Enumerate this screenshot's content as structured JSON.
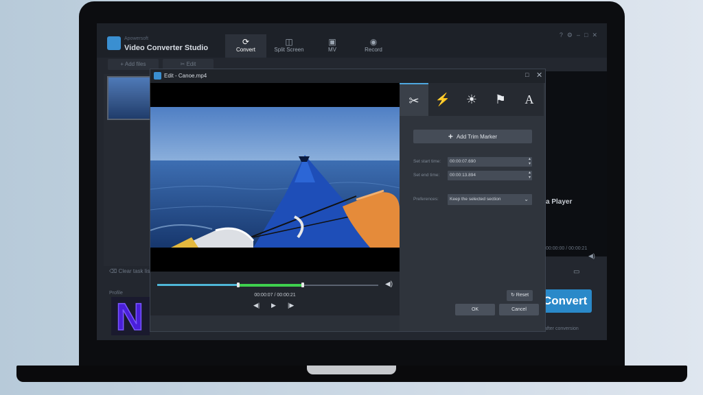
{
  "app": {
    "brand": "Apowersoft",
    "title": "Video Converter Studio",
    "tabs": [
      {
        "label": "Convert",
        "icon": "refresh-icon"
      },
      {
        "label": "Split Screen",
        "icon": "split-screen-icon"
      },
      {
        "label": "MV",
        "icon": "mv-icon"
      },
      {
        "label": "Record",
        "icon": "record-icon"
      }
    ],
    "toolbar": {
      "add_files": "Add files",
      "edit": "Edit"
    },
    "clear_task_list": "Clear task list",
    "profile_label": "Profile",
    "player_text": "a Player",
    "right_time": "00:00:00 / 00:00:21",
    "convert_label": "Convert",
    "after_conversion": "after conversion"
  },
  "dialog": {
    "title": "Edit - Canoe.mp4",
    "tool_tabs": [
      {
        "name": "trim",
        "icon": "scissors-icon",
        "glyph": "✂"
      },
      {
        "name": "effect",
        "icon": "magic-wand-icon",
        "glyph": "⚡"
      },
      {
        "name": "adjust",
        "icon": "brightness-icon",
        "glyph": "☀"
      },
      {
        "name": "watermark",
        "icon": "stamp-icon",
        "glyph": "⚑"
      },
      {
        "name": "subtitle",
        "icon": "text-icon",
        "glyph": "A"
      }
    ],
    "add_trim_marker": "Add Trim Marker",
    "start_label": "Set start time:",
    "start_value": "00:00:07.690",
    "end_label": "Set end time:",
    "end_value": "00:00:13.894",
    "pref_label": "Preferences:",
    "pref_value": "Keep the selected section",
    "time_readout": "00:00:07 / 00:00:21",
    "reset": "Reset",
    "ok": "OK",
    "cancel": "Cancel"
  },
  "playback": {
    "played_fraction": 0.37,
    "selection_start": 0.37,
    "selection_end": 0.66
  },
  "colors": {
    "accent": "#2a89c9",
    "selection": "#3fd04e",
    "played": "#4fb7d8"
  },
  "watermark_letter": "N"
}
